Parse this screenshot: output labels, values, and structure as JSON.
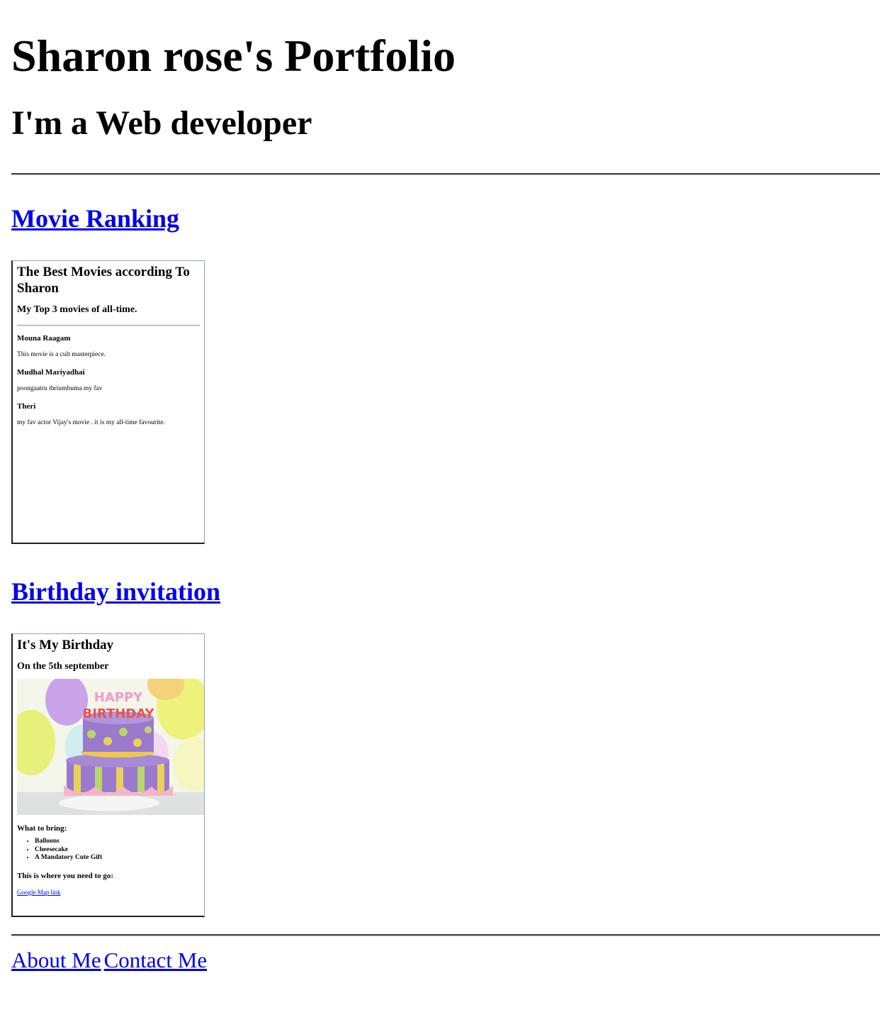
{
  "header": {
    "title": "Sharon rose's Portfolio",
    "subtitle": "I'm a Web developer"
  },
  "projects": {
    "movie": {
      "link_label": "Movie Ranking",
      "heading": "The Best Movies according To Sharon",
      "subheading": "My Top 3 movies of all-time.",
      "movies": [
        {
          "title": "Mouna Raagam",
          "desc": "This movie is a cult masterpiece."
        },
        {
          "title": "Mudhal Mariyadhai",
          "desc": "poongaatru thriumbuma my fav"
        },
        {
          "title": "Theri",
          "desc": "my fav actor Vijay's movie . it is my all-time favourite."
        }
      ]
    },
    "birthday": {
      "link_label": "Birthday invitation",
      "heading": "It's My Birthday",
      "date": "On the 5th september",
      "cake_text_top": "HAPPY",
      "cake_text_bottom": "BIRTHDAY",
      "bring_heading": "What to bring:",
      "bring_items": [
        "Balloons",
        "Cheesecake",
        "A Mandatory Cute Gift"
      ],
      "where_heading": "This is where you need to go:",
      "map_link": "Google Map link"
    }
  },
  "footer": {
    "about": "About Me",
    "contact": "Contact Me"
  },
  "colors": {
    "link": "#0000ee",
    "text": "#000000"
  }
}
